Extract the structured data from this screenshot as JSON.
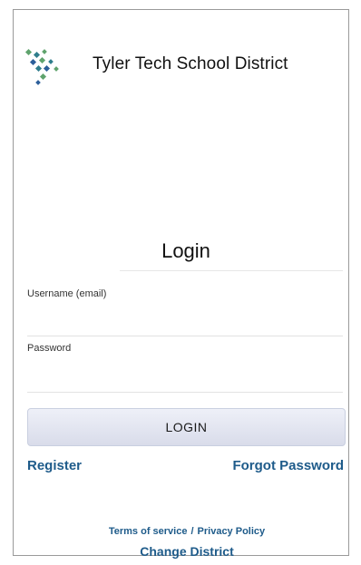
{
  "brand": {
    "district_name": "Tyler Tech School District",
    "logo_icon": "tyler-diamond-dots-logo",
    "logo_colors": [
      "#2f7d8c",
      "#5fa36d",
      "#2d5f9a"
    ]
  },
  "login": {
    "title": "Login",
    "username_label": "Username (email)",
    "username_value": "",
    "password_label": "Password",
    "password_value": "",
    "submit_label": "LOGIN"
  },
  "links": {
    "register": "Register",
    "forgot_password": "Forgot Password",
    "terms": "Terms of service",
    "separator": "/",
    "privacy": "Privacy Policy",
    "change_district": "Change District"
  },
  "colors": {
    "link": "#1e5b8a",
    "button_bg": "#dfe2ee"
  }
}
